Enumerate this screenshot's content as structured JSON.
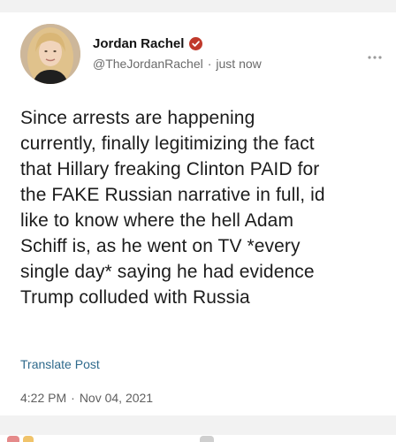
{
  "post": {
    "author": {
      "display_name": "Jordan Rachel",
      "handle": "@TheJordanRachel",
      "posted_relative": "just now",
      "verified_badge_color": "#c0392b",
      "avatar_icon": "profile-photo"
    },
    "text_lines": [
      "Since arrests are happening",
      "currently, finally legitimizing the fact",
      "that Hillary freaking Clinton PAID for",
      "the FAKE Russian narrative in full, id",
      "like to know where the hell Adam",
      "Schiff is, as he went on TV *every",
      "single day* saying he had evidence",
      "Trump colluded with Russia"
    ],
    "translate_label": "Translate Post",
    "time": "4:22 PM",
    "date": "Nov 04, 2021",
    "separator": "·"
  },
  "icons": {
    "more": "more-horizontal-icon",
    "verified": "verified-badge-icon"
  },
  "colors": {
    "link": "#2f6a8c",
    "muted_text": "#6a6a6a",
    "background_strip": "#f2f2f2"
  }
}
